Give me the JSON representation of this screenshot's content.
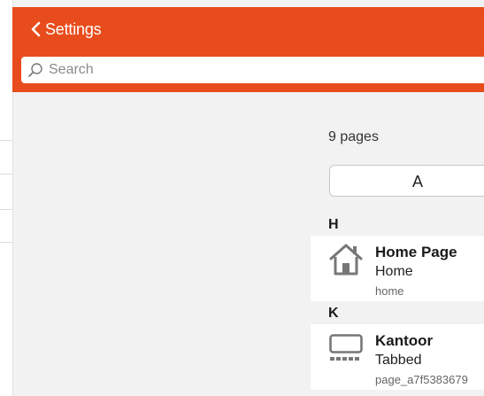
{
  "header": {
    "back_label": "Settings",
    "accent_color": "#e84c1c"
  },
  "search": {
    "placeholder": "Search",
    "value": ""
  },
  "pages": {
    "count_label": "9 pages",
    "add_button_label": "A",
    "groups": [
      {
        "letter": "H",
        "items": [
          {
            "title": "Home Page",
            "type": "Home",
            "id": "home",
            "icon": "home-icon"
          }
        ]
      },
      {
        "letter": "K",
        "items": [
          {
            "title": "Kantoor",
            "type": "Tabbed",
            "id": "page_a7f5383679",
            "icon": "tabbed-page-icon"
          }
        ]
      }
    ]
  }
}
